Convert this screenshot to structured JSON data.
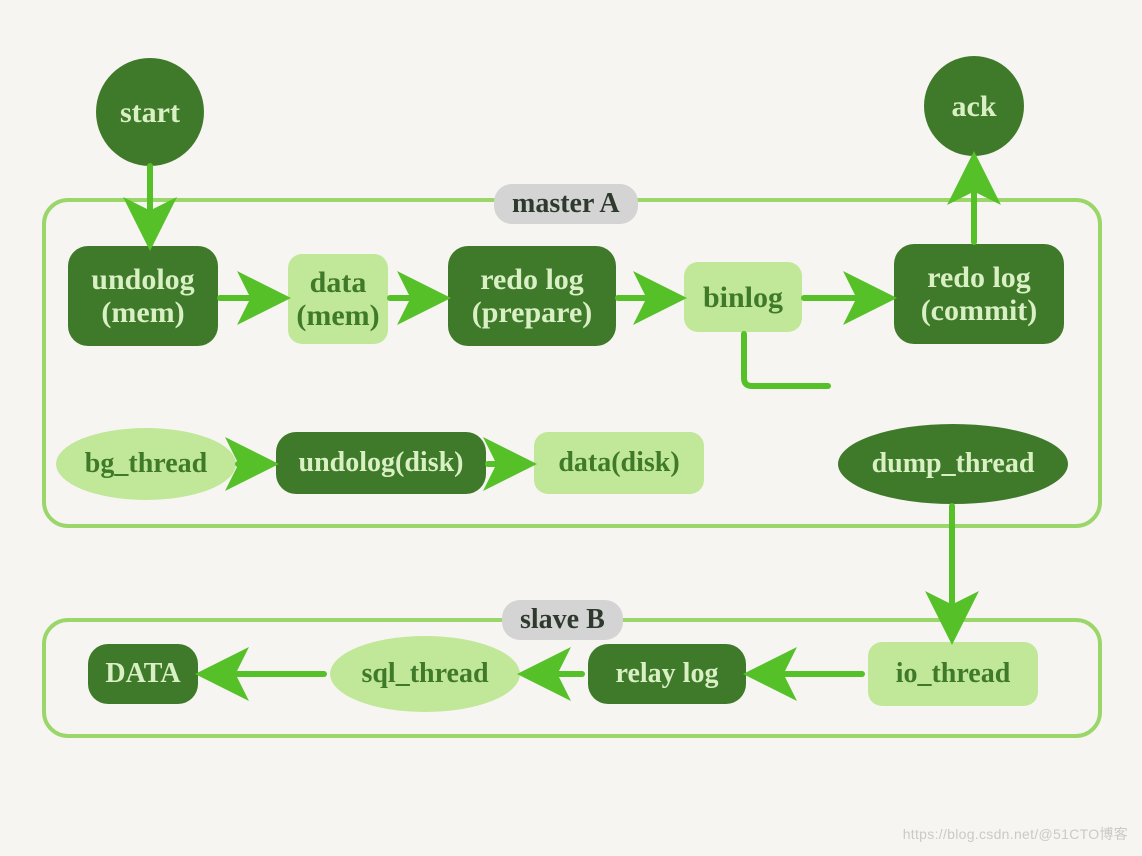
{
  "groups": {
    "master": "master A",
    "slave": "slave B"
  },
  "nodes": {
    "start": "start",
    "ack": "ack",
    "undolog_mem": "undolog\n(mem)",
    "data_mem": "data\n(mem)",
    "redo_prepare": "redo log\n(prepare)",
    "binlog": "binlog",
    "redo_commit": "redo log\n(commit)",
    "bg_thread": "bg_thread",
    "undolog_disk": "undolog(disk)",
    "data_disk": "data(disk)",
    "dump_thread": "dump_thread",
    "io_thread": "io_thread",
    "relay_log": "relay log",
    "sql_thread": "sql_thread",
    "data_final": "DATA"
  },
  "watermark": "https://blog.csdn.net/@51CTO博客"
}
